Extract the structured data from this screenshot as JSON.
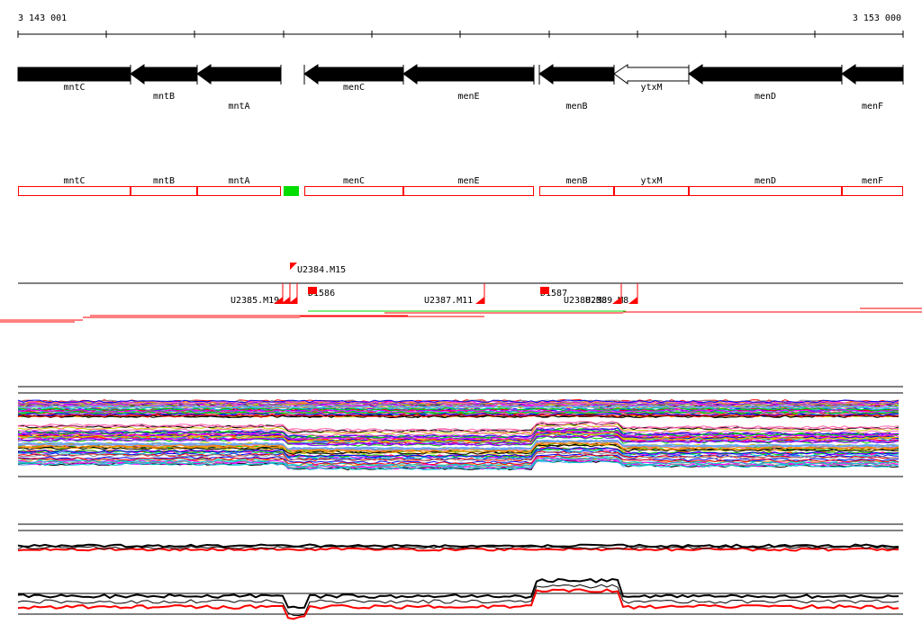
{
  "ruler": {
    "start_label": "3 143 001",
    "end_label": "3 153 000"
  },
  "genes": [
    {
      "name": "mntC",
      "strand": "-",
      "fill": "black"
    },
    {
      "name": "mntB",
      "strand": "-",
      "fill": "black"
    },
    {
      "name": "mntA",
      "strand": "-",
      "fill": "black"
    },
    {
      "name": "menC",
      "strand": "-",
      "fill": "black"
    },
    {
      "name": "menE",
      "strand": "-",
      "fill": "black"
    },
    {
      "name": "menB",
      "strand": "-",
      "fill": "black"
    },
    {
      "name": "ytxM",
      "strand": "-",
      "fill": "white"
    },
    {
      "name": "menD",
      "strand": "-",
      "fill": "black"
    },
    {
      "name": "menF",
      "strand": "-",
      "fill": "black"
    }
  ],
  "features": [
    {
      "label": "U2384.M15"
    },
    {
      "label": "U2385.M19"
    },
    {
      "label": "D1586"
    },
    {
      "label": "U2387.M11"
    },
    {
      "label": "D1587"
    },
    {
      "label": "U2388.M8"
    },
    {
      "label": "U2389.M8"
    }
  ],
  "colors": {
    "gene": "#000000",
    "box": "#ff0000",
    "marker": "#00dd00",
    "red": "#ff0000",
    "green": "#00dd00"
  }
}
